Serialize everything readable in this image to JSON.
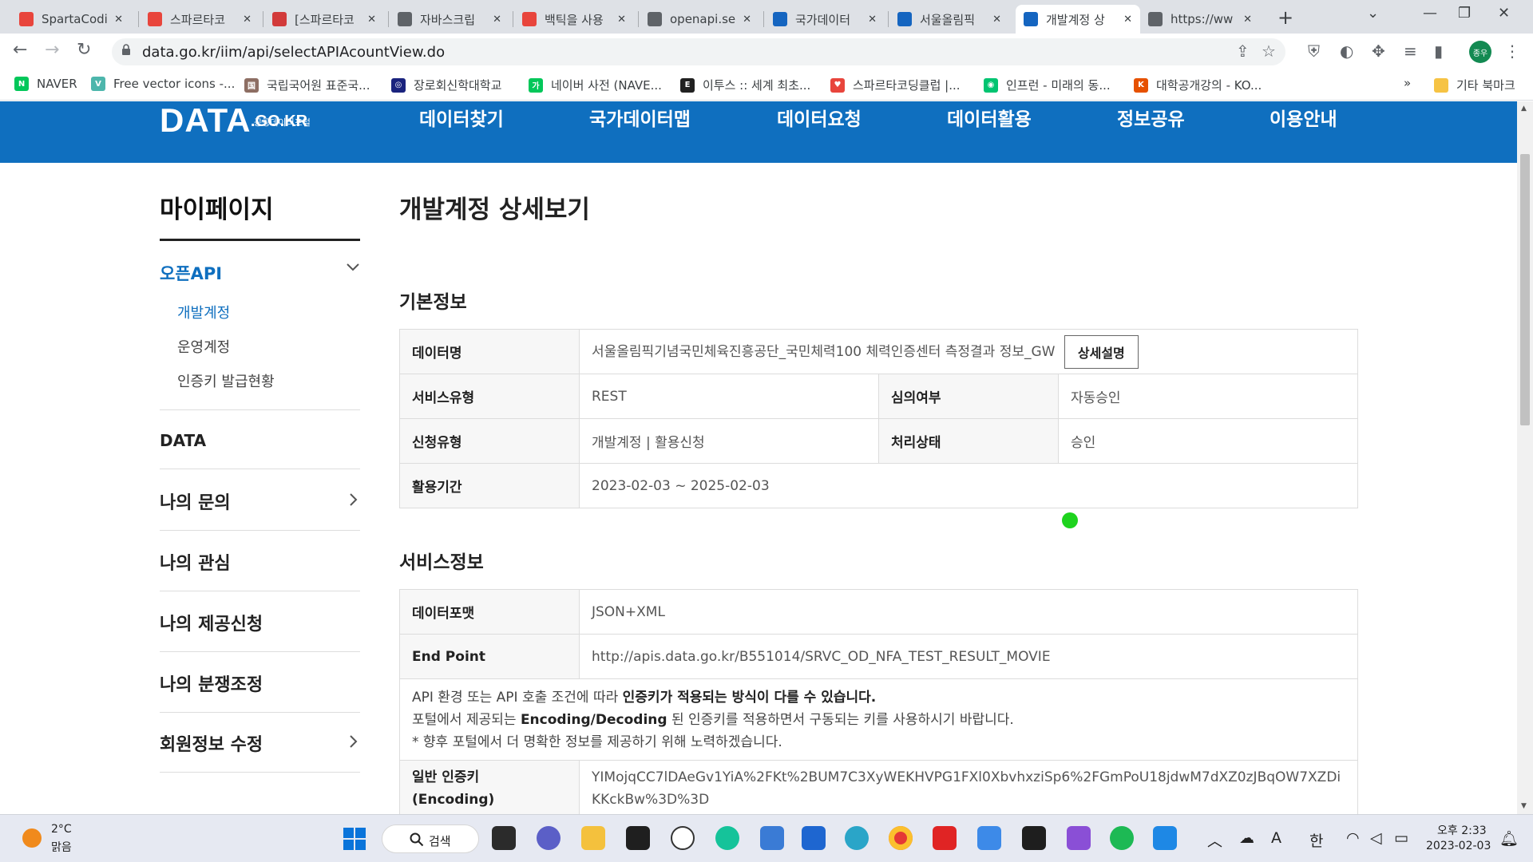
{
  "browser": {
    "tabs": [
      {
        "title": "SpartaCodi",
        "color": "#e8453c"
      },
      {
        "title": "스파르타코",
        "color": "#e8453c"
      },
      {
        "title": "[스파르타코",
        "color": "#d23a3a"
      },
      {
        "title": "자바스크립",
        "color": "#5f6368"
      },
      {
        "title": "백틱을 사용",
        "color": "#e8453c"
      },
      {
        "title": "openapi.se",
        "color": "#5f6368"
      },
      {
        "title": "국가데이터",
        "color": "#1565c0"
      },
      {
        "title": "서울올림픽",
        "color": "#1565c0"
      },
      {
        "title": "개발계정 상",
        "color": "#1565c0"
      },
      {
        "title": "https://ww",
        "color": "#5f6368"
      }
    ],
    "url": "data.go.kr/iim/api/selectAPIAcountView.do",
    "profile_label": "종우",
    "bookmarks": [
      {
        "label": "NAVER",
        "color": "#03c75a",
        "icon": "N"
      },
      {
        "label": "Free vector icons -...",
        "color": "#4db6ac",
        "icon": "V"
      },
      {
        "label": "국립국어원 표준국...",
        "color": "#8d6e63",
        "icon": "国"
      },
      {
        "label": "장로회신학대학교",
        "color": "#1a237e",
        "icon": "◎"
      },
      {
        "label": "네이버 사전 (NAVE...",
        "color": "#03c75a",
        "icon": "가"
      },
      {
        "label": "이투스 :: 세계 최초...",
        "color": "#212121",
        "icon": "E"
      },
      {
        "label": "스파르타코딩클럽 |...",
        "color": "#e8453c",
        "icon": "♥"
      },
      {
        "label": "인프런 - 미래의 동...",
        "color": "#00c471",
        "icon": "◉"
      },
      {
        "label": "대학공개강의 - KO...",
        "color": "#e65100",
        "icon": "K"
      }
    ],
    "other_bookmarks": "기타 북마크",
    "bookmarks_more": "»"
  },
  "site": {
    "logo_text": "DATA",
    "logo_small": "공공데이터포털",
    "logo_domain": ".GO.KR",
    "nav": [
      "데이터찾기",
      "국가데이터맵",
      "데이터요청",
      "데이터활용",
      "정보공유",
      "이용안내"
    ]
  },
  "sidebar": {
    "title": "마이페이지",
    "open_api": "오픈API",
    "sub_items": [
      "개발계정",
      "운영계정",
      "인증키 발급현황"
    ],
    "data_label": "DATA",
    "items": [
      "나의 문의",
      "나의 관심",
      "나의 제공신청",
      "나의 분쟁조정",
      "회원정보 수정"
    ]
  },
  "main": {
    "title": "개발계정 상세보기",
    "basic_title": "기본정보",
    "basic": {
      "data_name_label": "데이터명",
      "data_name": "서울올림픽기념국민체육진흥공단_국민체력100 체력인증센터 측정결과 정보_GW",
      "detail_button": "상세설명",
      "service_type_label": "서비스유형",
      "service_type": "REST",
      "review_label": "심의여부",
      "review": "자동승인",
      "request_type_label": "신청유형",
      "request_type": "개발계정 | 활용신청",
      "status_label": "처리상태",
      "status": "승인",
      "period_label": "활용기간",
      "period": "2023-02-03 ~ 2025-02-03"
    },
    "service_title": "서비스정보",
    "service": {
      "format_label": "데이터포맷",
      "format": "JSON+XML",
      "endpoint_label": "End Point",
      "endpoint": "http://apis.data.go.kr/B551014/SRVC_OD_NFA_TEST_RESULT_MOVIE",
      "notice_1a": "API 환경 또는 API 호출 조건에 따라 ",
      "notice_1b": "인증키가 적용되는 방식이 다를 수 있습니다.",
      "notice_2a": "포털에서 제공되는 ",
      "notice_2b": "Encoding/Decoding",
      "notice_2c": " 된 인증키를 적용하면서 구동되는 키를 사용하시기 바랍니다.",
      "notice_3": "* 향후 포털에서 더 명확한 정보를 제공하기 위해 노력하겠습니다.",
      "key_label_1": "일반 인증키",
      "key_label_2": "(Encoding)",
      "key_value": "YIMojqCC7lDAeGv1YiA%2FKt%2BUM7C3XyWEKHVPG1FXl0XbvhxziSp6%2FGmPoU18jdwM7dXZ0zJBqOW7XZDiKKckBw%3D%3D"
    }
  },
  "taskbar": {
    "temp": "2°C",
    "weather": "맑음",
    "search": "검색",
    "tray_ime_a": "A",
    "tray_ime_han": "한",
    "time": "오후 2:33",
    "date": "2023-02-03"
  },
  "colors": {
    "brand_blue": "#0f6fbf",
    "cursor_green": "#1ed31e"
  }
}
